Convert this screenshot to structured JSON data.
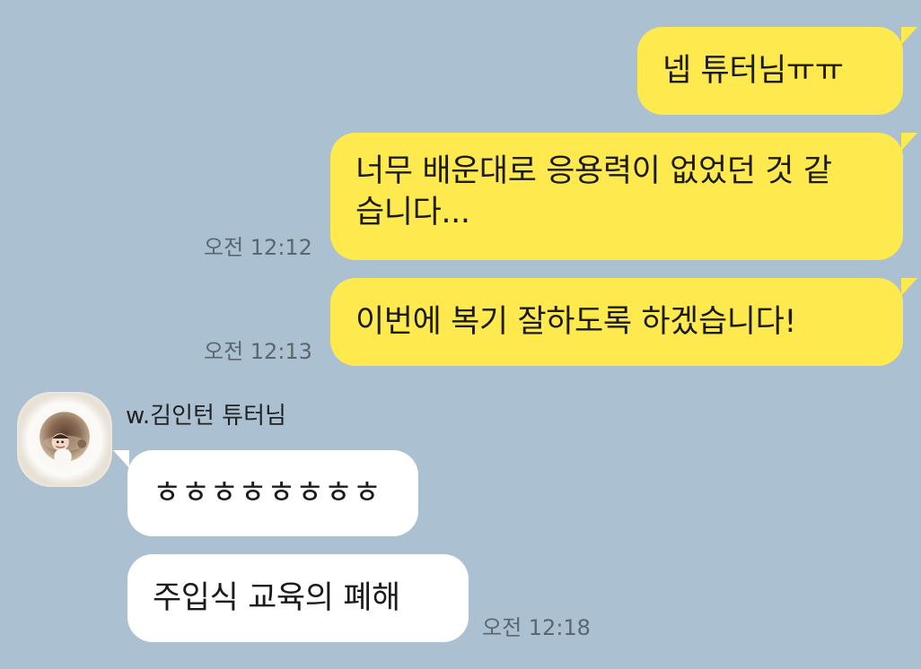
{
  "theme": {
    "background": "#abc1d1",
    "outgoing_bubble": "#fee94f",
    "incoming_bubble": "#ffffff",
    "timestamp": "#5b6770"
  },
  "messages": {
    "outgoing": [
      {
        "text": "넵 튜터님ㅠㅠ"
      },
      {
        "text": "너무 배운대로 응용력이 없었던 것 같습니다...",
        "time": "오전 12:12"
      },
      {
        "text": "이번에 복기 잘하도록 하겠습니다!",
        "time": "오전 12:13"
      }
    ],
    "incoming": {
      "sender": "w.김인턴 튜터님",
      "avatar_icon": "profile-photo-icon",
      "items": [
        {
          "text": "ㅎㅎㅎㅎㅎㅎㅎㅎ"
        },
        {
          "text": "주입식 교육의 폐해",
          "time": "오전 12:18"
        }
      ]
    }
  }
}
